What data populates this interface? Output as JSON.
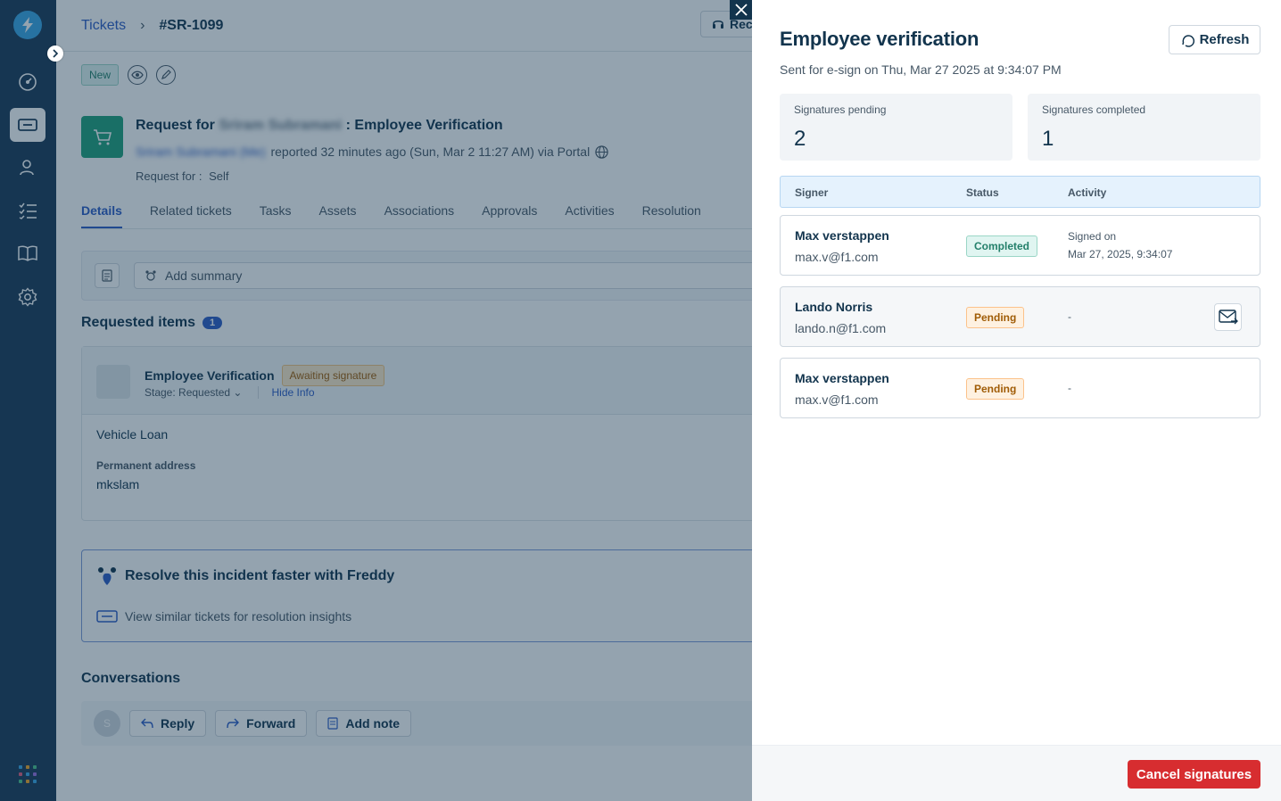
{
  "breadcrumb": {
    "tickets": "Tickets",
    "ticket_id": "#SR-1099"
  },
  "top_button": "Rec",
  "toolbar": {
    "status_badge": "New"
  },
  "request": {
    "title_prefix": "Request for",
    "requester_blurred": "Sriram Subramani",
    "title_suffix": ": Employee Verification",
    "reporter_blurred": "Sriram Subramani (Me)",
    "reported_text": "reported 32 minutes ago (Sun, Mar 2 11:27 AM) via Portal",
    "request_for_label": "Request for :",
    "request_for_value": "Self"
  },
  "tabs": [
    "Details",
    "Related tickets",
    "Tasks",
    "Assets",
    "Associations",
    "Approvals",
    "Activities",
    "Resolution"
  ],
  "summary": {
    "placeholder": "Add summary"
  },
  "requested_items": {
    "title": "Requested items",
    "count": "1",
    "item_name": "Employee Verification",
    "item_badge": "Awaiting signature",
    "stage_label": "Stage: Requested",
    "hide_info": "Hide Info",
    "field_value_1": "Vehicle Loan",
    "field_label_2": "Permanent address",
    "field_value_2": "mkslam"
  },
  "freddy": {
    "title": "Resolve this incident faster with Freddy",
    "link": "View similar tickets for resolution insights"
  },
  "conversations": {
    "title": "Conversations",
    "avatar_initial": "S",
    "reply": "Reply",
    "forward": "Forward",
    "add_note": "Add note"
  },
  "drawer": {
    "title": "Employee verification",
    "subtitle": "Sent for e-sign on Thu, Mar 27 2025 at 9:34:07 PM",
    "refresh": "Refresh",
    "stats": [
      {
        "label": "Signatures pending",
        "value": "2"
      },
      {
        "label": "Signatures completed",
        "value": "1"
      }
    ],
    "columns": {
      "signer": "Signer",
      "status": "Status",
      "activity": "Activity"
    },
    "rows": [
      {
        "name": "Max verstappen",
        "email": "max.v@f1.com",
        "status": "Completed",
        "activity_line1": "Signed on",
        "activity_line2": "Mar 27, 2025, 9:34:07"
      },
      {
        "name": "Lando Norris",
        "email": "lando.n@f1.com",
        "status": "Pending",
        "activity_line1": "-",
        "activity_line2": ""
      },
      {
        "name": "Max verstappen",
        "email": "max.v@f1.com",
        "status": "Pending",
        "activity_line1": "-",
        "activity_line2": ""
      }
    ],
    "cancel": "Cancel signatures"
  },
  "colors": {
    "nav_bg": "#1b3a57",
    "accent": "#2c5cc5",
    "danger": "#d72d30",
    "completed": "#24806b",
    "pending": "#a05c06"
  }
}
